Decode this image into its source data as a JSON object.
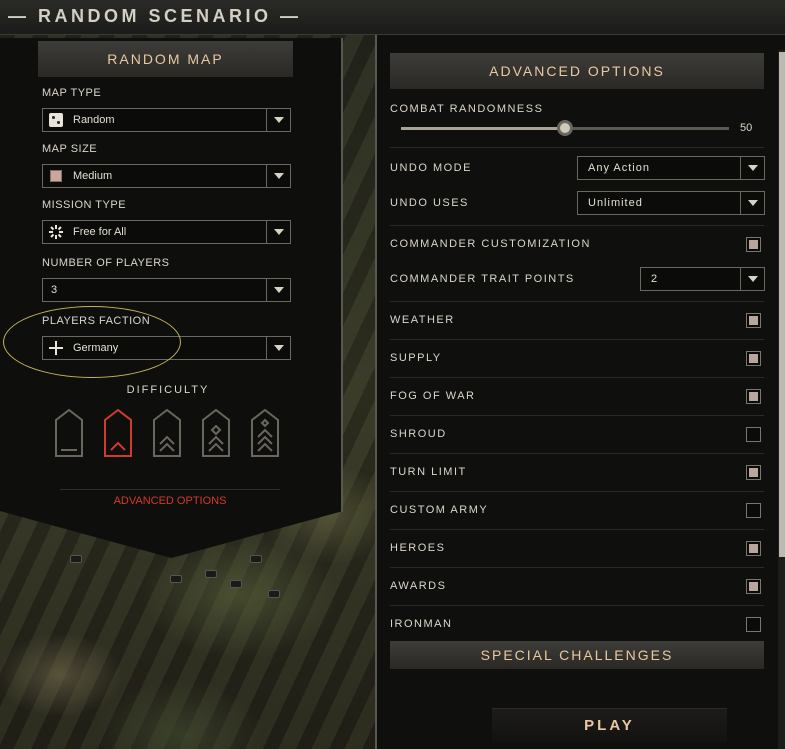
{
  "window": {
    "title": "RANDOM SCENARIO"
  },
  "left": {
    "header": "RANDOM MAP",
    "fields": [
      {
        "label": "MAP TYPE",
        "value": "Random",
        "icon": "die-icon"
      },
      {
        "label": "MAP SIZE",
        "value": "Medium",
        "icon": "map-size-icon"
      },
      {
        "label": "MISSION TYPE",
        "value": "Free for All",
        "icon": "starburst-icon"
      },
      {
        "label": "NUMBER OF PLAYERS",
        "value": "3",
        "icon": ""
      },
      {
        "label": "PLAYERS FACTION",
        "value": "Germany",
        "icon": "balkenkreuz-icon"
      }
    ],
    "difficulty": {
      "label": "DIFFICULTY",
      "levels": 5,
      "selected_index": 1
    },
    "advanced_link": "ADVANCED OPTIONS"
  },
  "right": {
    "header": "ADVANCED OPTIONS",
    "combat_randomness": {
      "label": "COMBAT RANDOMNESS",
      "value": "50",
      "fraction": 0.5
    },
    "undo_mode": {
      "label": "UNDO MODE",
      "value": "Any Action"
    },
    "undo_uses": {
      "label": "UNDO USES",
      "value": "Unlimited"
    },
    "commander_customization": {
      "label": "COMMANDER CUSTOMIZATION",
      "checked": true
    },
    "commander_trait_points": {
      "label": "COMMANDER TRAIT POINTS",
      "value": "2"
    },
    "toggles": [
      {
        "label": "WEATHER",
        "checked": true
      },
      {
        "label": "SUPPLY",
        "checked": true
      },
      {
        "label": "FOG OF WAR",
        "checked": true
      },
      {
        "label": "SHROUD",
        "checked": false
      },
      {
        "label": "TURN LIMIT",
        "checked": true
      },
      {
        "label": "CUSTOM ARMY",
        "checked": false
      },
      {
        "label": "HEROES",
        "checked": true
      },
      {
        "label": "AWARDS",
        "checked": true
      },
      {
        "label": "IRONMAN",
        "checked": false
      }
    ],
    "special_challenges": "SPECIAL CHALLENGES",
    "play": "PLAY"
  },
  "colors": {
    "accent_gold": "#e8c9a0",
    "link_red": "#d23a2a",
    "selected_red": "#d23a2a",
    "annotation_yellow": "#c8b657"
  }
}
